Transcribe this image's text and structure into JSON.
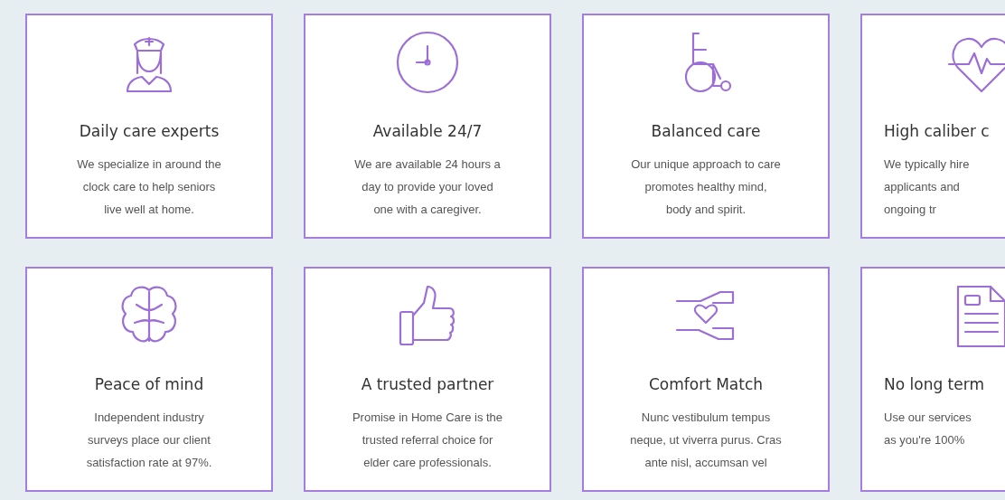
{
  "features": [
    {
      "title": "Daily care experts",
      "lines": [
        "We specialize in around the",
        "clock care to help seniors",
        "live well at home."
      ],
      "cropped": false
    },
    {
      "title": "Available 24/7",
      "lines": [
        "We are available 24 hours a",
        "day to provide your loved",
        "one with a caregiver."
      ],
      "cropped": false
    },
    {
      "title": "Balanced care",
      "lines": [
        "Our unique approach to care",
        "promotes healthy mind,",
        "body and spirit."
      ],
      "cropped": false
    },
    {
      "title": "High caliber c",
      "lines": [
        "We typically hire",
        "applicants and",
        "ongoing tr"
      ],
      "cropped": true
    },
    {
      "title": "Peace of mind",
      "lines": [
        "Independent industry",
        "surveys place our client",
        "satisfaction rate at 97%."
      ],
      "cropped": false
    },
    {
      "title": "A trusted partner",
      "lines": [
        "Promise in Home Care is the",
        "trusted referral choice for",
        "elder care professionals."
      ],
      "cropped": false
    },
    {
      "title": "Comfort Match",
      "lines": [
        "Nunc vestibulum tempus",
        "neque, ut viverra purus. Cras",
        "ante nisl, accumsan vel"
      ],
      "cropped": false
    },
    {
      "title": "No long term",
      "lines": [
        "Use our services",
        "as you're 100%"
      ],
      "cropped": true
    }
  ]
}
